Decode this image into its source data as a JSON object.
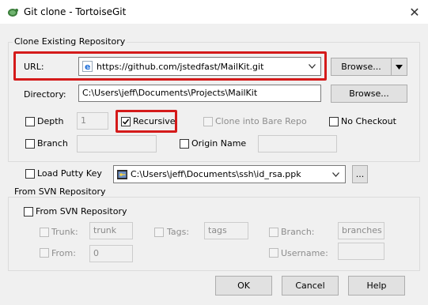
{
  "window": {
    "title": "Git clone - TortoiseGit",
    "close_glyph": "✕"
  },
  "clone_group": {
    "label": "Clone Existing Repository",
    "url_label": "URL:",
    "url_value": "https://github.com/jstedfast/MailKit.git",
    "browse_label": "Browse...",
    "directory_label": "Directory:",
    "directory_value": "C:\\Users\\jeff\\Documents\\Projects\\MailKit",
    "browse2_label": "Browse...",
    "depth_label": "Depth",
    "depth_value": "1",
    "recursive_label": "Recursive",
    "recursive_checked": true,
    "bare_label": "Clone into Bare Repo",
    "nocheckout_label": "No Checkout",
    "branch_label": "Branch",
    "origin_label": "Origin Name"
  },
  "putty": {
    "label": "Load Putty Key",
    "path": "C:\\Users\\jeff\\Documents\\ssh\\id_rsa.ppk",
    "more_label": "..."
  },
  "svn_group": {
    "label": "From SVN Repository",
    "checkbox_label": "From SVN Repository",
    "trunk_label": "Trunk:",
    "trunk_value": "trunk",
    "tags_label": "Tags:",
    "tags_value": "tags",
    "branch_label": "Branch:",
    "branch_value": "branches",
    "from_label": "From:",
    "from_value": "0",
    "username_label": "Username:"
  },
  "buttons": {
    "ok": "OK",
    "cancel": "Cancel",
    "help": "Help"
  },
  "colors": {
    "highlight": "#d41a1a",
    "ie_icon": "#1e6fd9"
  }
}
